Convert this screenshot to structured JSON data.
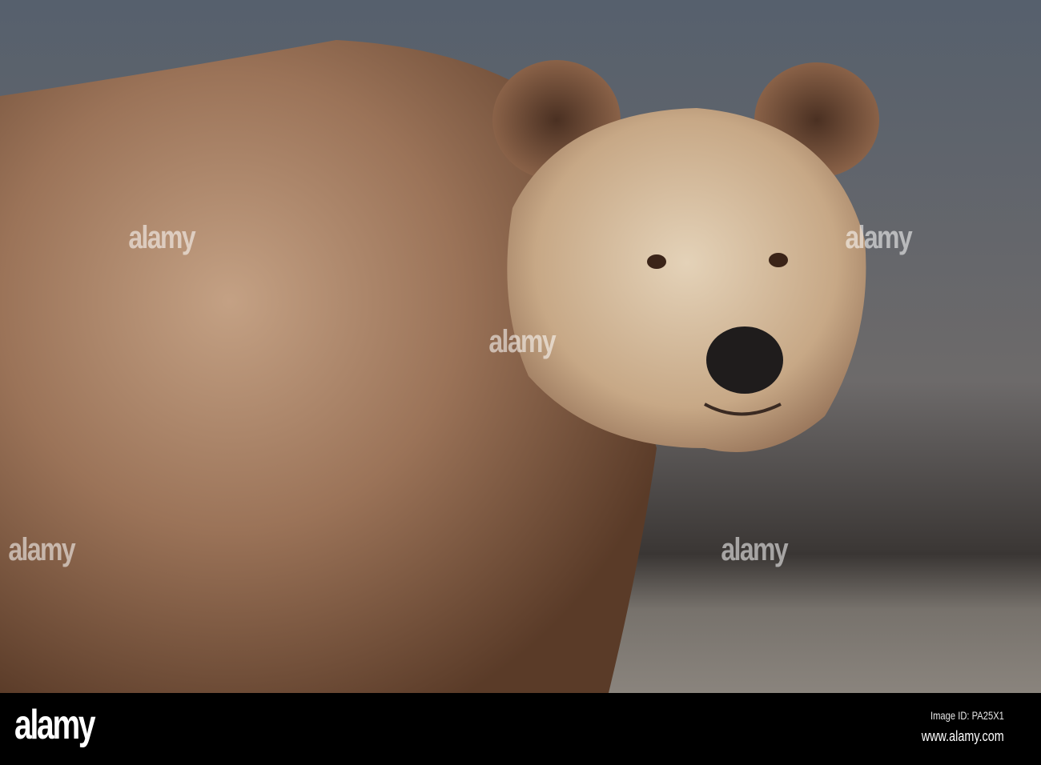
{
  "photo": {
    "subject": "brown bear",
    "colors": {
      "background": "#5f6670",
      "fur_dark": "#6e4a32",
      "fur_light": "#c9a98a",
      "face": "#d9c2a5",
      "nose": "#1f1c1c"
    }
  },
  "watermark": {
    "text": "alamy"
  },
  "footer": {
    "logo": "alamy",
    "image_id": "Image ID: PA25X1",
    "url": "www.alamy.com"
  }
}
